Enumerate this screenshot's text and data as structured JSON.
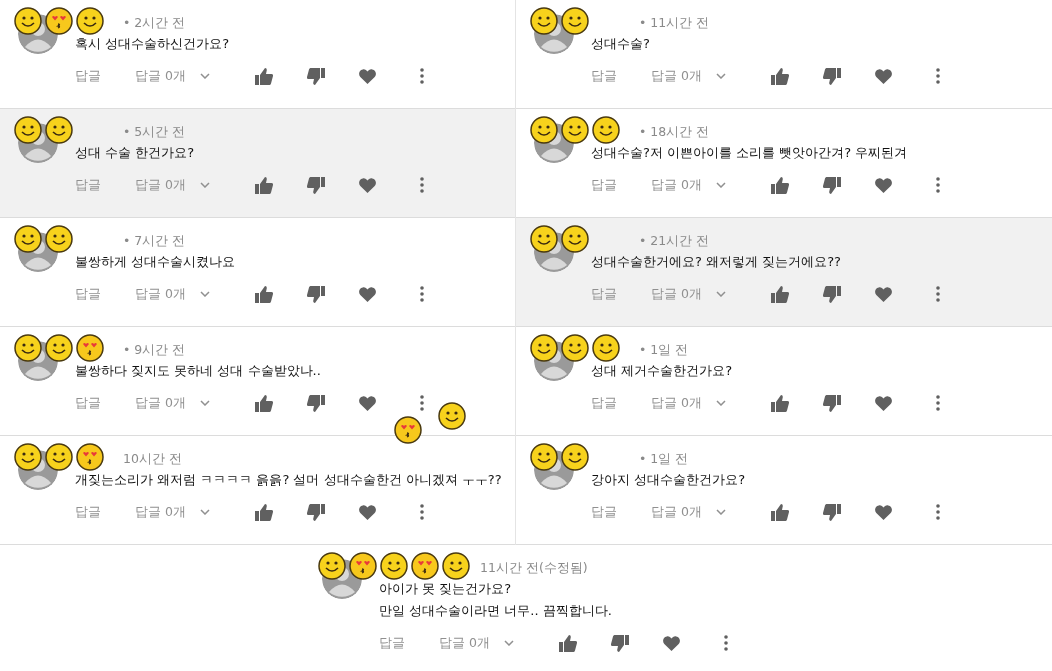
{
  "columns": [
    {
      "comments": [
        {
          "stickers": [
            {
              "kind": "smile"
            },
            {
              "kind": "heart-eyes"
            },
            {
              "kind": "smile"
            }
          ],
          "meta": "• 2시간 전",
          "lines": [
            "혹시 성대수술하신건가요?"
          ],
          "shaded": false,
          "reply": "답글",
          "replies": "답글 0개"
        },
        {
          "stickers": [
            {
              "kind": "smile"
            },
            {
              "kind": "smile"
            }
          ],
          "meta": "• 5시간 전",
          "lines": [
            "성대 수술 한건가요?"
          ],
          "shaded": true,
          "reply": "답글",
          "replies": "답글 0개"
        },
        {
          "stickers": [
            {
              "kind": "smile"
            },
            {
              "kind": "smile"
            }
          ],
          "meta": "• 7시간 전",
          "lines": [
            "불쌍하게 성대수술시켰나요"
          ],
          "shaded": false,
          "reply": "답글",
          "replies": "답글 0개"
        },
        {
          "stickers": [
            {
              "kind": "smile"
            },
            {
              "kind": "smile"
            },
            {
              "kind": "heart-eyes"
            }
          ],
          "meta": "• 9시간 전",
          "lines": [
            "불쌍하다 짖지도 못하네 성대 수술받았나.."
          ],
          "shaded": false,
          "reply": "답글",
          "replies": "답글 0개",
          "action_stickers": [
            {
              "kind": "heart-eyes"
            },
            {
              "kind": "smile"
            }
          ]
        },
        {
          "stickers": [
            {
              "kind": "smile"
            },
            {
              "kind": "smile"
            },
            {
              "kind": "heart-eyes"
            }
          ],
          "meta": "10시간 전",
          "lines": [
            "개짖는소리가 왜저럼 ㅋㅋㅋㅋ 읅읅? 설머 성대수술한건 아니겠져 ㅜㅜ??"
          ],
          "shaded": false,
          "reply": "답글",
          "replies": "답글 0개"
        }
      ]
    },
    {
      "comments": [
        {
          "stickers": [
            {
              "kind": "smile"
            },
            {
              "kind": "smile"
            }
          ],
          "meta": "• 11시간 전",
          "lines": [
            "성대수술?"
          ],
          "shaded": false,
          "reply": "답글",
          "replies": "답글 0개"
        },
        {
          "stickers": [
            {
              "kind": "smile"
            },
            {
              "kind": "smile"
            },
            {
              "kind": "smile"
            }
          ],
          "meta": "• 18시간 전",
          "lines": [
            "성대수술?저 이쁜아이를 소리를 뺏앗아간겨? 우찌된겨"
          ],
          "shaded": false,
          "reply": "답글",
          "replies": "답글 0개"
        },
        {
          "stickers": [
            {
              "kind": "smile"
            },
            {
              "kind": "smile"
            }
          ],
          "meta": "• 21시간 전",
          "lines": [
            "성대수술한거에요? 왜저렇게 짖는거에요??"
          ],
          "shaded": true,
          "reply": "답글",
          "replies": "답글 0개"
        },
        {
          "stickers": [
            {
              "kind": "smile"
            },
            {
              "kind": "smile"
            },
            {
              "kind": "smile"
            }
          ],
          "meta": "• 1일 전",
          "lines": [
            "성대 제거수술한건가요?"
          ],
          "shaded": false,
          "reply": "답글",
          "replies": "답글 0개"
        },
        {
          "stickers": [
            {
              "kind": "smile"
            },
            {
              "kind": "smile"
            }
          ],
          "meta": "• 1일 전",
          "lines": [
            "강아지 성대수술한건가요?"
          ],
          "shaded": false,
          "reply": "답글",
          "replies": "답글 0개"
        }
      ]
    }
  ],
  "bottom": {
    "stickers": [
      {
        "kind": "smile"
      },
      {
        "kind": "heart-eyes"
      },
      {
        "kind": "smile"
      },
      {
        "kind": "heart-eyes"
      },
      {
        "kind": "smile"
      }
    ],
    "meta": "11시간 전(수정됨)",
    "lines": [
      "아이가 못 짖는건가요?",
      "만일 성대수술이라면 너무.. 끔찍합니다."
    ],
    "reply": "답글",
    "replies": "답글 0개"
  }
}
